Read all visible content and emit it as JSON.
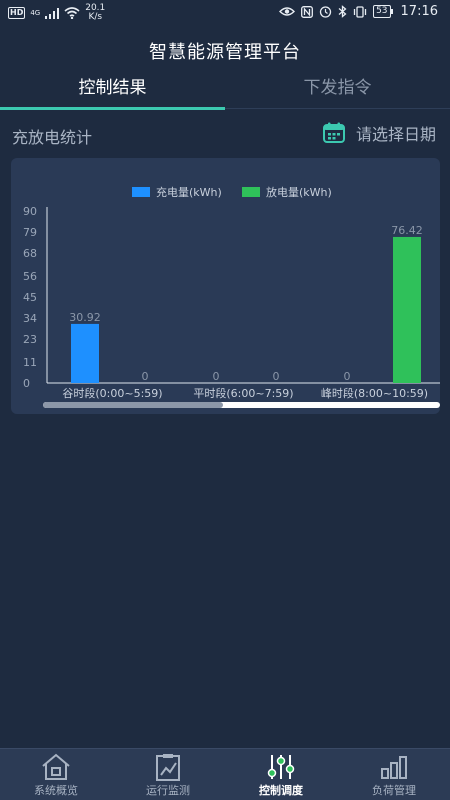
{
  "status_bar": {
    "hd": "HD",
    "network": "4G",
    "speed_value": "20.1",
    "speed_unit": "K/s",
    "battery": "53",
    "time": "17:16"
  },
  "header": {
    "title": "智慧能源管理平台"
  },
  "tabs": [
    {
      "label": "控制结果",
      "active": true
    },
    {
      "label": "下发指令",
      "active": false
    }
  ],
  "section": {
    "title": "充放电统计",
    "date_picker_label": "请选择日期"
  },
  "chart_data": {
    "type": "bar",
    "categories": [
      "谷时段(0:00~5:59)",
      "平时段(6:00~7:59)",
      "峰时段(8:00~10:59)"
    ],
    "series": [
      {
        "name": "充电量(kWh)",
        "values": [
          30.92,
          0,
          0
        ],
        "color": "#1e90ff"
      },
      {
        "name": "放电量(kWh)",
        "values": [
          0,
          0,
          76.42
        ],
        "color": "#2fc15a"
      }
    ],
    "value_labels": [
      [
        "30.92",
        "0",
        "0"
      ],
      [
        "0",
        "0",
        "76.42"
      ]
    ],
    "y_ticks": [
      0,
      11,
      23,
      34,
      45,
      56,
      68,
      79,
      90
    ],
    "ylim": [
      0,
      90
    ],
    "legend_position": "top-center",
    "grid": false
  },
  "bottom_nav": [
    {
      "label": "系统概览",
      "icon": "home-icon",
      "active": false
    },
    {
      "label": "运行监测",
      "icon": "monitor-chart-icon",
      "active": false
    },
    {
      "label": "控制调度",
      "icon": "sliders-icon",
      "active": true
    },
    {
      "label": "负荷管理",
      "icon": "bar-chart-icon",
      "active": false
    }
  ],
  "colors": {
    "background": "#1e2b40",
    "card": "#2a3a56",
    "accent": "#3cc9b0",
    "charge": "#1e90ff",
    "discharge": "#2fc15a"
  }
}
